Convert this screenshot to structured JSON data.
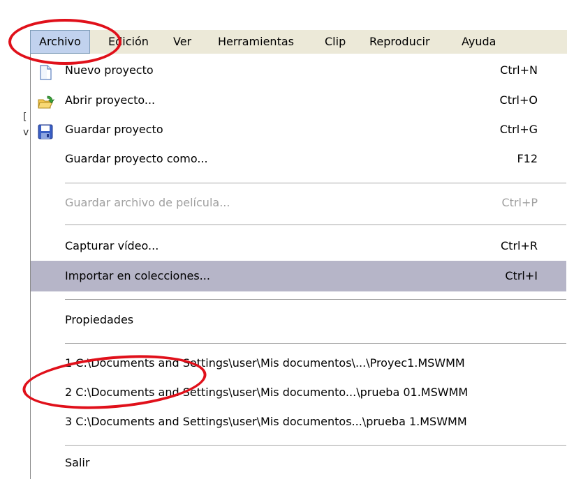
{
  "menubar": {
    "items": [
      "Archivo",
      "Edición",
      "Ver",
      "Herramientas",
      "Clip",
      "Reproducir",
      "Ayuda"
    ]
  },
  "menu": {
    "items": [
      {
        "label": "Nuevo proyecto",
        "shortcut": "Ctrl+N",
        "icon": "new-document-icon"
      },
      {
        "label": "Abrir proyecto...",
        "shortcut": "Ctrl+O",
        "icon": "open-folder-icon"
      },
      {
        "label": "Guardar proyecto",
        "shortcut": "Ctrl+G",
        "icon": "save-disk-icon"
      },
      {
        "label": "Guardar proyecto como...",
        "shortcut": "F12"
      },
      {
        "label": "Guardar archivo de película...",
        "shortcut": "Ctrl+P",
        "disabled": true
      },
      {
        "label": "Capturar vídeo...",
        "shortcut": "Ctrl+R"
      },
      {
        "label": "Importar en colecciones...",
        "shortcut": "Ctrl+I",
        "highlighted": true
      },
      {
        "label": "Propiedades"
      },
      {
        "label": "1 C:\\Documents and Settings\\user\\Mis documentos\\...\\Proyec1.MSWMM"
      },
      {
        "label": "2 C:\\Documents and Settings\\user\\Mis documento...\\prueba 01.MSWMM"
      },
      {
        "label": "3 C:\\Documents and Settings\\user\\Mis documentos...\\prueba 1.MSWMM"
      },
      {
        "label": "Salir"
      }
    ]
  },
  "colors": {
    "menubar_bg": "#ece9d8",
    "highlight_bg": "#b6b5c8",
    "annotation_red": "#e0101a"
  }
}
